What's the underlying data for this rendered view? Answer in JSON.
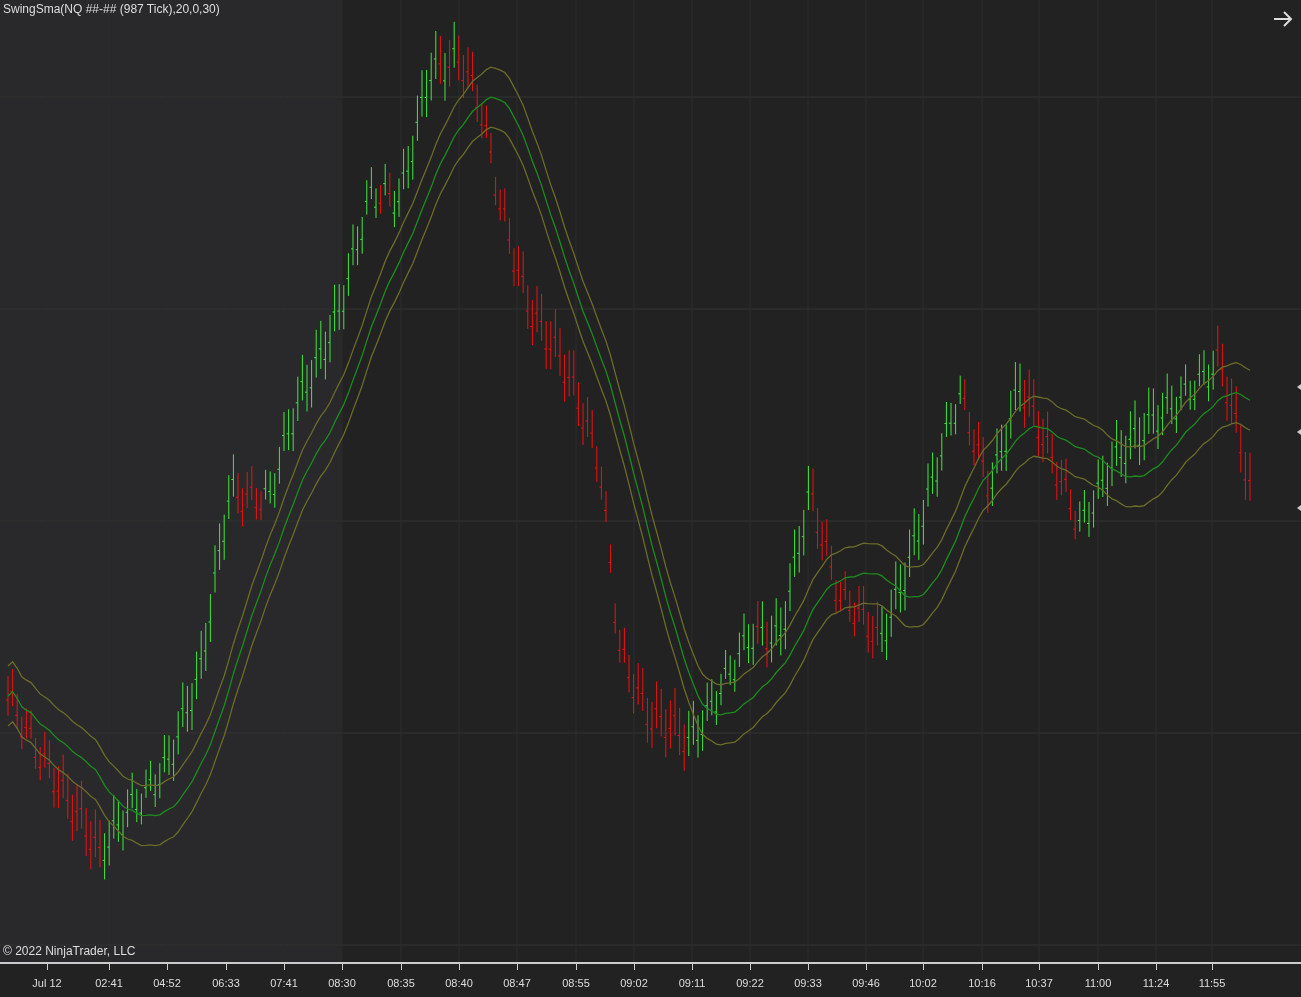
{
  "indicator_label": "SwingSma(NQ ##-## (987 Tick),20,0,30)",
  "copyright": "© 2022 NinjaTrader, LLC",
  "x_axis": {
    "labels": [
      "Jul 12",
      "02:41",
      "04:52",
      "06:33",
      "07:41",
      "08:30",
      "08:35",
      "08:40",
      "08:47",
      "08:55",
      "09:02",
      "09:11",
      "09:22",
      "09:33",
      "09:46",
      "10:02",
      "10:16",
      "10:37",
      "11:00",
      "11:24",
      "11:55"
    ]
  }
}
